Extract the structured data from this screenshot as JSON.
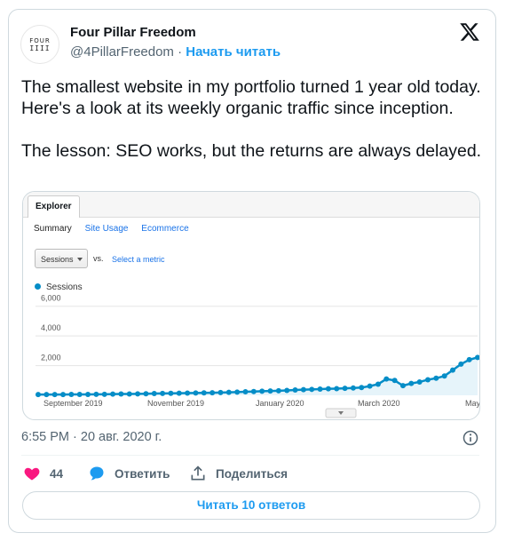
{
  "author": {
    "avatar_line1": "FOUR",
    "avatar_line2": "IIII",
    "name": "Four Pillar Freedom",
    "handle": "@4PillarFreedom",
    "separator": "·",
    "follow_label": "Начать читать"
  },
  "tweet": {
    "text": "The smallest website in my portfolio turned 1 year old today. Here's a look at its weekly organic traffic since inception.\n\nThe lesson: SEO works, but the returns are always delayed."
  },
  "analytics": {
    "tab": "Explorer",
    "subtabs": [
      "Summary",
      "Site Usage",
      "Ecommerce"
    ],
    "select_value": "Sessions",
    "vs_label": "vs.",
    "metric_link": "Select a metric",
    "legend_label": "Sessions",
    "colors": {
      "line": "#058dc7",
      "fill": "#e6f4fa",
      "grid": "#e5e5e5"
    }
  },
  "chart_data": {
    "type": "area",
    "series": [
      {
        "name": "Sessions",
        "values": [
          50,
          50,
          55,
          55,
          60,
          60,
          60,
          65,
          70,
          80,
          90,
          90,
          100,
          105,
          120,
          125,
          135,
          145,
          150,
          155,
          165,
          175,
          185,
          200,
          220,
          240,
          255,
          275,
          290,
          310,
          330,
          360,
          380,
          400,
          420,
          440,
          450,
          470,
          490,
          520,
          620,
          750,
          1100,
          1000,
          650,
          800,
          900,
          1050,
          1150,
          1300,
          1700,
          2100,
          2400,
          2550
        ]
      }
    ],
    "x_tick_labels": [
      "September 2019",
      "November 2019",
      "January 2020",
      "March 2020",
      "May"
    ],
    "y_tick_labels": [
      "6,000",
      "4,000",
      "2,000"
    ],
    "ylim": [
      0,
      7000
    ],
    "grid": true
  },
  "timestamp": "6:55 PM · 20 авг. 2020 г.",
  "actions": {
    "likes_count": "44",
    "reply_label": "Ответить",
    "share_label": "Поделиться"
  },
  "read_replies_label": "Читать 10 ответов"
}
